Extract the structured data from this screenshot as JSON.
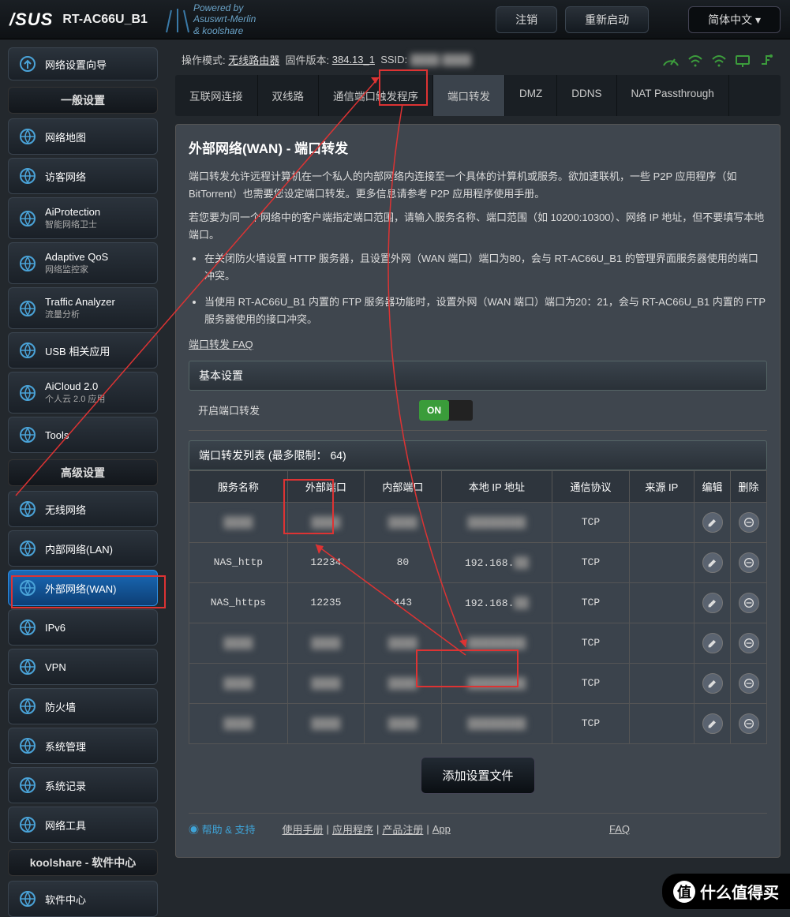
{
  "header": {
    "brand": "/SUS",
    "model": "RT-AC66U_B1",
    "tagline1": "Powered by",
    "tagline2": "Asuswrt-Merlin",
    "tagline3": "& koolshare",
    "logout": "注销",
    "reboot": "重新启动",
    "lang": "简体中文"
  },
  "infobar": {
    "mode_label": "操作模式:",
    "mode": "无线路由器",
    "fw_label": "固件版本:",
    "fw": "384.13_1",
    "ssid_label": "SSID:"
  },
  "sidebar": {
    "wizard": "网络设置向导",
    "general_header": "一般设置",
    "general": [
      {
        "label": "网络地图"
      },
      {
        "label": "访客网络"
      },
      {
        "label": "AiProtection",
        "sub": "智能网络卫士"
      },
      {
        "label": "Adaptive QoS",
        "sub": "网络监控家"
      },
      {
        "label": "Traffic Analyzer",
        "sub": "流量分析"
      },
      {
        "label": "USB 相关应用"
      },
      {
        "label": "AiCloud 2.0",
        "sub": "个人云 2.0 应用"
      },
      {
        "label": "Tools"
      }
    ],
    "advanced_header": "高级设置",
    "advanced": [
      {
        "label": "无线网络"
      },
      {
        "label": "内部网络(LAN)"
      },
      {
        "label": "外部网络(WAN)"
      },
      {
        "label": "IPv6"
      },
      {
        "label": "VPN"
      },
      {
        "label": "防火墙"
      },
      {
        "label": "系统管理"
      },
      {
        "label": "系统记录"
      },
      {
        "label": "网络工具"
      }
    ],
    "kool_header": "koolshare - 软件中心",
    "kool": [
      {
        "label": "软件中心"
      }
    ]
  },
  "tabs": [
    "互联网连接",
    "双线路",
    "通信端口触发程序",
    "端口转发",
    "DMZ",
    "DDNS",
    "NAT Passthrough"
  ],
  "panel": {
    "title": "外部网络(WAN) - 端口转发",
    "p1": "端口转发允许远程计算机在一个私人的内部网络内连接至一个具体的计算机或服务。欲加速联机，一些 P2P 应用程序（如 BitTorrent）也需要您设定端口转发。更多信息请参考 P2P 应用程序使用手册。",
    "p2": "若您要为同一个网络中的客户端指定端口范围，请输入服务名称、端口范围（如 10200:10300）、网络 IP 地址，但不要填写本地端口。",
    "li1": "在关闭防火墙设置 HTTP 服务器，且设置外网（WAN 端口）端口为80，会与 RT-AC66U_B1 的管理界面服务器使用的端口冲突。",
    "li2": "当使用 RT-AC66U_B1 内置的 FTP 服务器功能时，设置外网（WAN 端口）端口为20：21，会与 RT-AC66U_B1 内置的 FTP 服务器使用的接口冲突。",
    "faq": "端口转发  FAQ",
    "basic": "基本设置",
    "enable_label": "开启端口转发",
    "toggle": "ON",
    "list_header": "端口转发列表 (最多限制：  64)",
    "cols": [
      "服务名称",
      "外部端口",
      "内部端口",
      "本地 IP 地址",
      "通信协议",
      "来源 IP",
      "编辑",
      "删除"
    ],
    "rows": [
      {
        "name": "",
        "ext": "",
        "int": "",
        "ip": "",
        "proto": "TCP",
        "src": ""
      },
      {
        "name": "NAS_http",
        "ext": "12234",
        "int": "80",
        "ip": "192.168.",
        "proto": "TCP",
        "src": ""
      },
      {
        "name": "NAS_https",
        "ext": "12235",
        "int": "443",
        "ip": "192.168.",
        "proto": "TCP",
        "src": ""
      },
      {
        "name": "",
        "ext": "",
        "int": "",
        "ip": "",
        "proto": "TCP",
        "src": ""
      },
      {
        "name": "",
        "ext": "",
        "int": "",
        "ip": "",
        "proto": "TCP",
        "src": ""
      },
      {
        "name": "",
        "ext": "",
        "int": "",
        "ip": "",
        "proto": "TCP",
        "src": ""
      }
    ],
    "add_btn": "添加设置文件"
  },
  "footer": {
    "help": "帮助 & 支持",
    "manual": "使用手册",
    "app": "应用程序",
    "reg": "产品注册",
    "appstore": "App",
    "faq": "FAQ"
  },
  "watermark": "什么值得买"
}
